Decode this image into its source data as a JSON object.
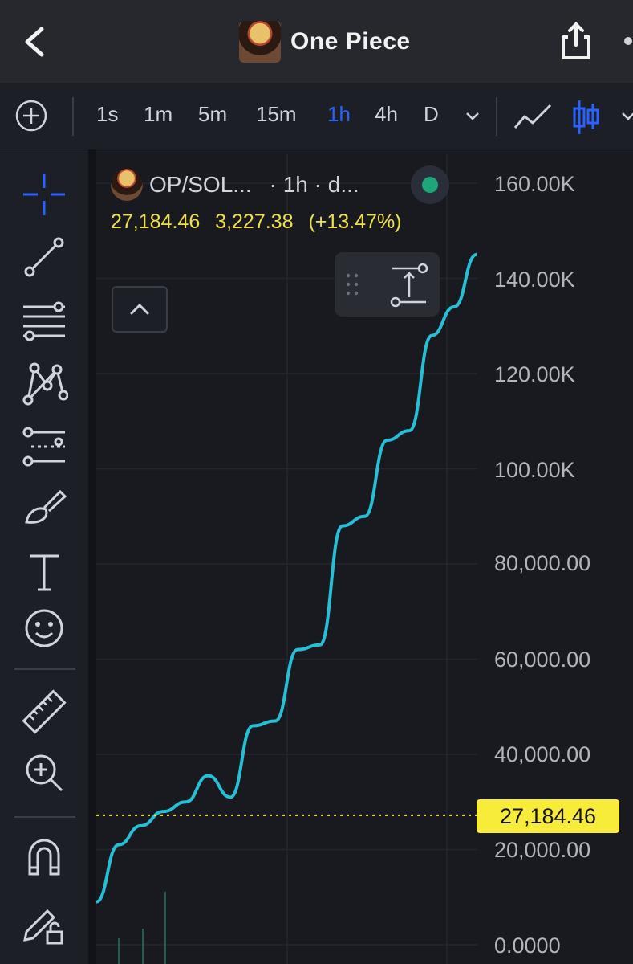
{
  "header": {
    "title": "One Piece",
    "back_icon": "chevron-left-icon",
    "share_icon": "share-icon",
    "more_icon": "more-icon"
  },
  "toolbar": {
    "timeframes": [
      "1s",
      "1m",
      "5m",
      "15m",
      "1h",
      "4h",
      "D"
    ],
    "active_timeframe": "1h",
    "chart_type_icons": [
      "line-chart-icon",
      "candlestick-icon"
    ]
  },
  "left_tools": [
    "crosshair-icon",
    "trendline-icon",
    "fib-retracement-icon",
    "pattern-icon",
    "projection-icon",
    "brush-icon",
    "text-icon",
    "emoji-icon",
    "ruler-icon",
    "zoom-in-icon",
    "magnet-icon",
    "lock-drawing-icon"
  ],
  "legend": {
    "symbol": "OP/SOL...",
    "interval": "· 1h · d...",
    "last": "27,184.46",
    "change": "3,227.38",
    "change_pct": "(+13.47%)"
  },
  "colors": {
    "line": "#26bfd6",
    "active_timeframe": "#2962ff",
    "price_tag_bg": "#f7ec3a",
    "legend_values": "#f0e04a",
    "status_dot": "#1fa57a"
  },
  "chart_data": {
    "type": "line",
    "y_axis_labels": [
      "160.00K",
      "140.00K",
      "120.00K",
      "100.00K",
      "80,000.00",
      "60,000.00",
      "40,000.00",
      "20,000.00",
      "0.0000"
    ],
    "ylim": [
      0,
      160000
    ],
    "current_price": 27184.46,
    "current_price_label": "27,184.46",
    "series": [
      {
        "values": [
          9000,
          21000,
          25000,
          28000,
          30000,
          35500,
          31000,
          46000,
          47000,
          62000,
          63000,
          88000,
          90000,
          106000,
          108000,
          128000,
          134000,
          145000
        ]
      }
    ],
    "grid": true
  }
}
